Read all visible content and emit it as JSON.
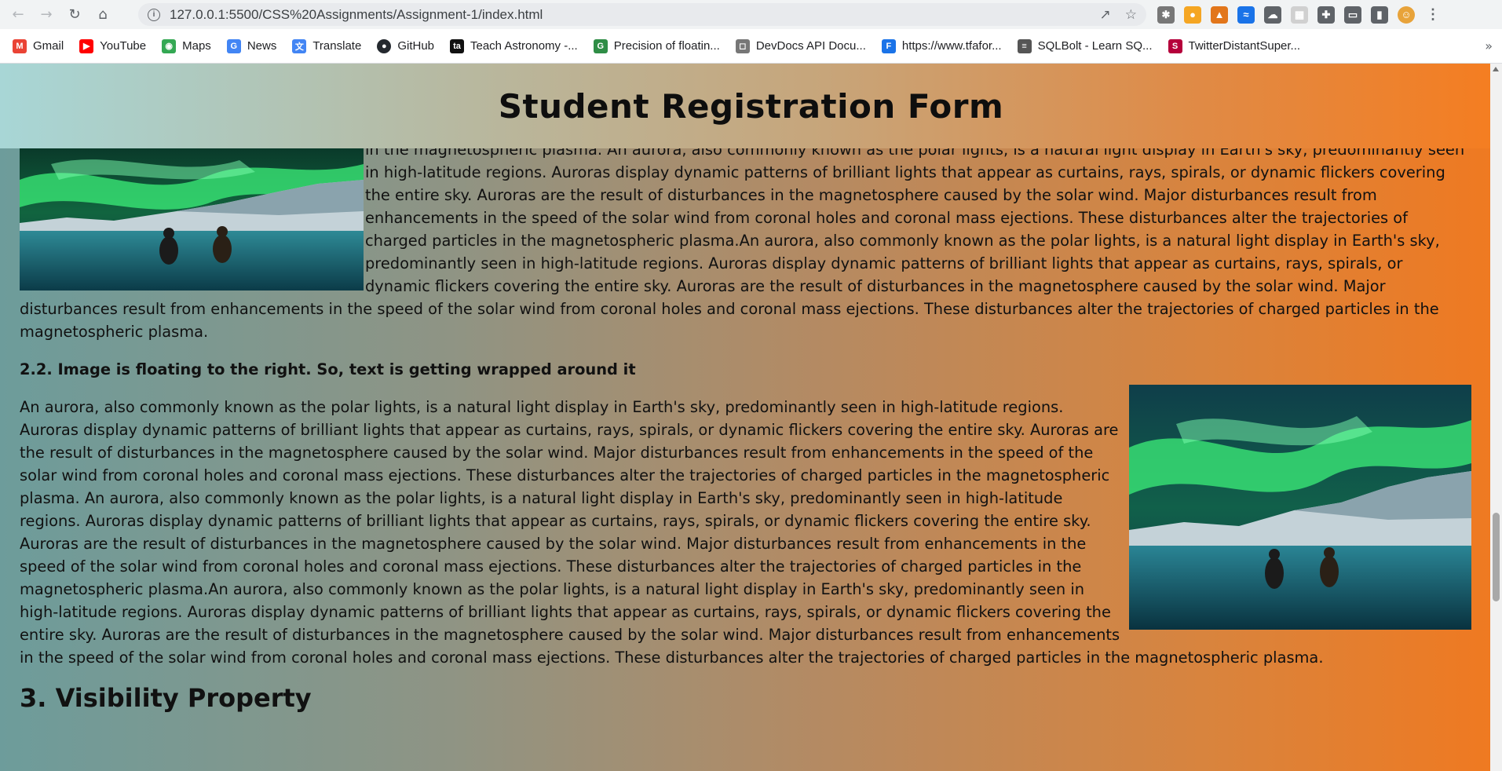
{
  "browser": {
    "url": "127.0.0.1:5500/CSS%20Assignments/Assignment-1/index.html",
    "bookmarks": [
      {
        "label": "Gmail",
        "icon": "gmail-icon",
        "color": "#ea4335",
        "glyph": "M"
      },
      {
        "label": "YouTube",
        "icon": "youtube-icon",
        "color": "#ff0000",
        "glyph": "▶"
      },
      {
        "label": "Maps",
        "icon": "maps-icon",
        "color": "#34a853",
        "glyph": "◉"
      },
      {
        "label": "News",
        "icon": "news-icon",
        "color": "#4285f4",
        "glyph": "G"
      },
      {
        "label": "Translate",
        "icon": "translate-icon",
        "color": "#4285f4",
        "glyph": "文"
      },
      {
        "label": "GitHub",
        "icon": "github-icon",
        "color": "#24292f",
        "glyph": "●"
      },
      {
        "label": "Teach Astronomy -...",
        "icon": "teach-astronomy-icon",
        "color": "#111111",
        "glyph": "ta"
      },
      {
        "label": "Precision of floatin...",
        "icon": "geeksforgeeks-icon",
        "color": "#2f8d46",
        "glyph": "G"
      },
      {
        "label": "DevDocs API Docu...",
        "icon": "devdocs-icon",
        "color": "#777777",
        "glyph": "◻"
      },
      {
        "label": "https://www.tfafor...",
        "icon": "tfa-icon",
        "color": "#1a73e8",
        "glyph": "F"
      },
      {
        "label": "SQLBolt - Learn SQ...",
        "icon": "sqlbolt-icon",
        "color": "#555555",
        "glyph": "≡"
      },
      {
        "label": "TwitterDistantSuper...",
        "icon": "twitterdistant-icon",
        "color": "#b5003b",
        "glyph": "S"
      }
    ]
  },
  "page": {
    "title": "Student Registration Form",
    "para1": "in the magnetospheric plasma. An aurora, also commonly known as the polar lights, is a natural light display in Earth's sky, predominantly seen in high-latitude regions. Auroras display dynamic patterns of brilliant lights that appear as curtains, rays, spirals, or dynamic flickers covering the entire sky. Auroras are the result of disturbances in the magnetosphere caused by the solar wind. Major disturbances result from enhancements in the speed of the solar wind from coronal holes and coronal mass ejections. These disturbances alter the trajectories of charged particles in the magnetospheric plasma.An aurora, also commonly known as the polar lights, is a natural light display in Earth's sky, predominantly seen in high-latitude regions. Auroras display dynamic patterns of brilliant lights that appear as curtains, rays, spirals, or dynamic flickers covering the entire sky. Auroras are the result of disturbances in the magnetosphere caused by the solar wind. Major disturbances result from enhancements in the speed of the solar wind from coronal holes and coronal mass ejections. These disturbances alter the trajectories of charged particles in the magnetospheric plasma.",
    "subheading": "2.2. Image is floating to the right. So, text is getting wrapped around it",
    "para2": "An aurora, also commonly known as the polar lights, is a natural light display in Earth's sky, predominantly seen in high-latitude regions. Auroras display dynamic patterns of brilliant lights that appear as curtains, rays, spirals, or dynamic flickers covering the entire sky. Auroras are the result of disturbances in the magnetosphere caused by the solar wind. Major disturbances result from enhancements in the speed of the solar wind from coronal holes and coronal mass ejections. These disturbances alter the trajectories of charged particles in the magnetospheric plasma. An aurora, also commonly known as the polar lights, is a natural light display in Earth's sky, predominantly seen in high-latitude regions. Auroras display dynamic patterns of brilliant lights that appear as curtains, rays, spirals, or dynamic flickers covering the entire sky. Auroras are the result of disturbances in the magnetosphere caused by the solar wind. Major disturbances result from enhancements in the speed of the solar wind from coronal holes and coronal mass ejections. These disturbances alter the trajectories of charged particles in the magnetospheric plasma.An aurora, also commonly known as the polar lights, is a natural light display in Earth's sky, predominantly seen in high-latitude regions. Auroras display dynamic patterns of brilliant lights that appear as curtains, rays, spirals, or dynamic flickers covering the entire sky. Auroras are the result of disturbances in the magnetosphere caused by the solar wind. Major disturbances result from enhancements in the speed of the solar wind from coronal holes and coronal mass ejections. These disturbances alter the trajectories of charged particles in the magnetospheric plasma.",
    "section_heading": "3. Visibility Property"
  },
  "colors": {
    "gradient_left": "#6d9c9b",
    "gradient_right": "#f07920",
    "header_left": "#a8d6d6",
    "header_right": "#f57d20"
  }
}
